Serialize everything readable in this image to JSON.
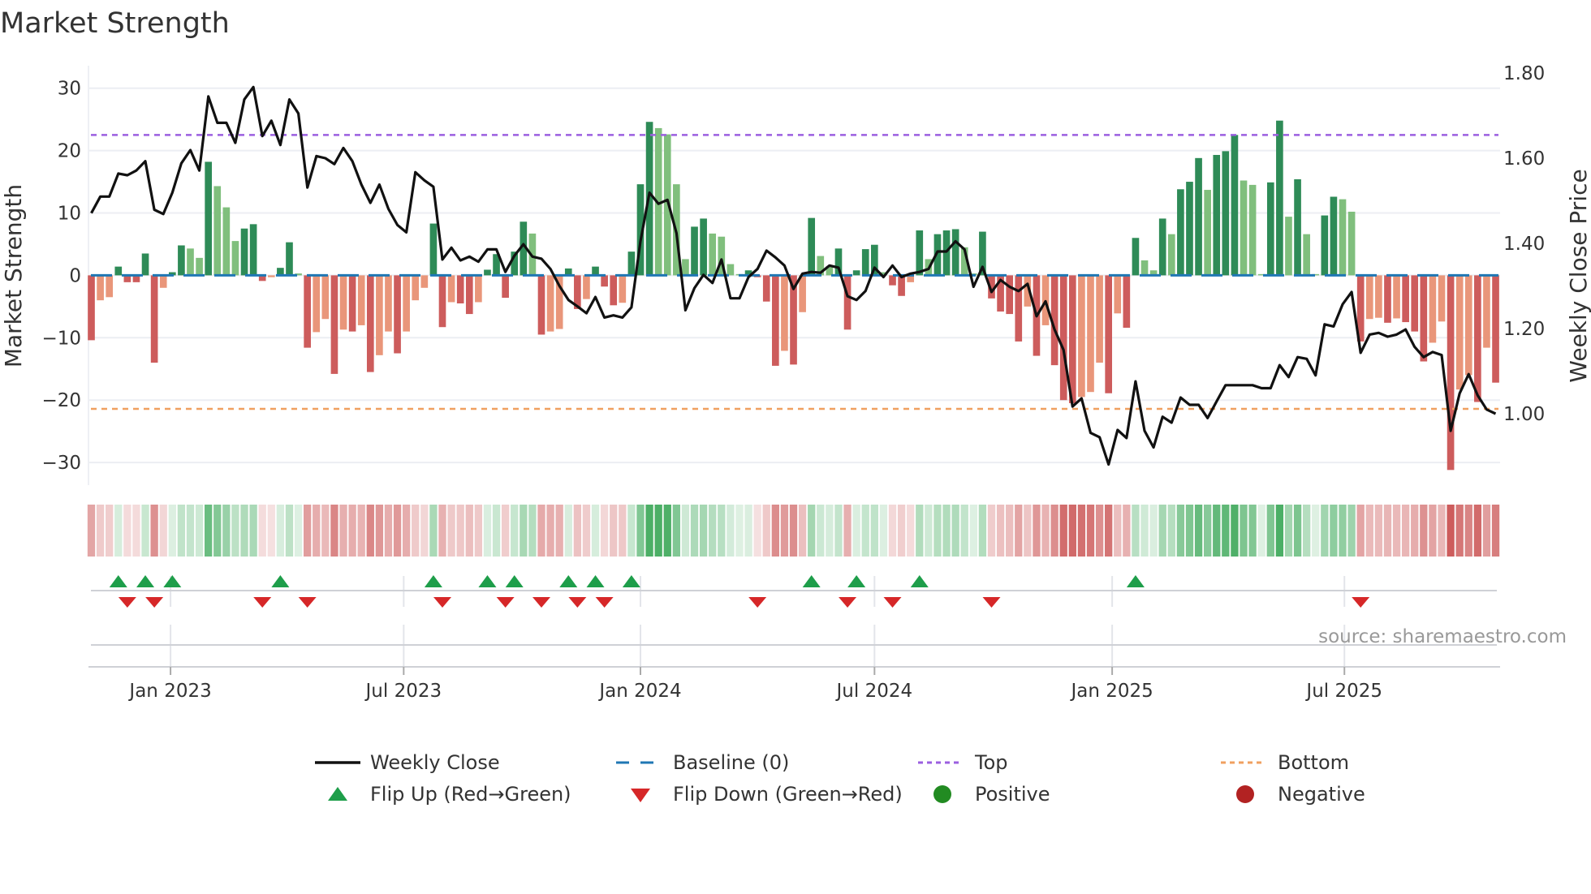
{
  "chart_data": {
    "type": "bar",
    "title": "Market Strength",
    "ylabel": "Market Strength",
    "y2label": "Weekly Close Price",
    "ylim": [
      -33,
      34
    ],
    "y2lim": [
      0.86,
      1.84
    ],
    "yticks": [
      30,
      20,
      10,
      0,
      -10,
      -20,
      -30
    ],
    "ytick_labels": [
      "30",
      "20",
      "10",
      "0",
      "−10",
      "−20",
      "−30"
    ],
    "y2ticks": [
      1.8,
      1.6,
      1.4,
      1.2,
      1.0
    ],
    "y2tick_labels": [
      "1.80",
      "1.60",
      "1.40",
      "1.20",
      "1.00"
    ],
    "xticks": [
      {
        "label": "Jan 2023",
        "week": 8.8
      },
      {
        "label": "Jul 2023",
        "week": 34.7
      },
      {
        "label": "Jan 2024",
        "week": 61.0
      },
      {
        "label": "Jul 2024",
        "week": 87.0
      },
      {
        "label": "Jan 2025",
        "week": 113.4
      },
      {
        "label": "Jul 2025",
        "week": 139.2
      }
    ],
    "grid": true,
    "top_level": 22.5,
    "bottom_level": -21.4,
    "baseline": 0,
    "strength": [
      -10.4,
      -4,
      -3.5,
      1.4,
      -1.1,
      -1.1,
      3.5,
      -14,
      -2,
      0.5,
      4.8,
      4.3,
      2.8,
      18.2,
      14.3,
      10.9,
      5.5,
      7.5,
      8.2,
      -0.9,
      -0.3,
      1.2,
      5.3,
      0.3,
      -11.6,
      -9.1,
      -7,
      -15.8,
      -8.7,
      -9,
      -8,
      -15.5,
      -12.8,
      -9,
      -12.5,
      -9,
      -4,
      -2,
      8.3,
      -8.3,
      -4.3,
      -4.5,
      -6.2,
      -4.3,
      0.9,
      3.4,
      -3.6,
      3.8,
      8.6,
      6.7,
      -9.5,
      -9,
      -8.6,
      1.1,
      -5.4,
      -3.8,
      1.4,
      -1.8,
      -4.8,
      -4.4,
      3.8,
      14.6,
      24.6,
      23.6,
      22.6,
      14.6,
      2.6,
      7.8,
      9.1,
      6.7,
      6.2,
      1.8,
      0.2,
      0.8,
      -0.3,
      -4.2,
      -14.5,
      -12.1,
      -14.3,
      -5.9,
      9.2,
      3.1,
      1.5,
      4.3,
      -8.7,
      0.8,
      4.2,
      4.9,
      0.5,
      -1.6,
      -3.3,
      -1.1,
      7.2,
      2.6,
      6.6,
      7.2,
      7.4,
      4.5,
      0.3,
      7,
      -3.7,
      -5.8,
      -6.2,
      -10.6,
      -5,
      -12.9,
      -8,
      -14.4,
      -20,
      -20.5,
      -19.5,
      -18.7,
      -14,
      -18.9,
      -6.1,
      -8.4,
      6,
      2.4,
      0.8,
      9.1,
      6.6,
      13.8,
      15,
      18.8,
      13.7,
      19.3,
      19.9,
      22.5,
      15.2,
      14.5,
      0.2,
      14.9,
      24.8,
      9.4,
      15.4,
      6.6,
      0.2,
      9.6,
      12.6,
      12.2,
      10.2,
      -10.6,
      -7,
      -6.8,
      -7.6,
      -6.9,
      -7.5,
      -9,
      -13.8,
      -10.8,
      -7.4,
      -31.2,
      -18.3,
      -16,
      -20.3,
      -11.6,
      -17.2
    ],
    "weekly_close": [
      1.471,
      1.51,
      1.51,
      1.564,
      1.56,
      1.571,
      1.593,
      1.479,
      1.469,
      1.519,
      1.588,
      1.619,
      1.571,
      1.745,
      1.683,
      1.683,
      1.636,
      1.738,
      1.767,
      1.652,
      1.688,
      1.631,
      1.738,
      1.705,
      1.531,
      1.605,
      1.6,
      1.586,
      1.624,
      1.593,
      1.538,
      1.495,
      1.538,
      1.481,
      1.443,
      1.426,
      1.567,
      1.548,
      1.533,
      1.362,
      1.39,
      1.36,
      1.369,
      1.357,
      1.386,
      1.386,
      1.333,
      1.371,
      1.398,
      1.369,
      1.364,
      1.34,
      1.3,
      1.267,
      1.252,
      1.236,
      1.274,
      1.226,
      1.231,
      1.226,
      1.25,
      1.405,
      1.519,
      1.493,
      1.502,
      1.424,
      1.243,
      1.295,
      1.326,
      1.307,
      1.362,
      1.271,
      1.271,
      1.321,
      1.34,
      1.383,
      1.367,
      1.348,
      1.293,
      1.329,
      1.333,
      1.331,
      1.348,
      1.343,
      1.276,
      1.267,
      1.288,
      1.343,
      1.321,
      1.348,
      1.321,
      1.329,
      1.333,
      1.34,
      1.381,
      1.381,
      1.405,
      1.386,
      1.298,
      1.345,
      1.286,
      1.314,
      1.298,
      1.288,
      1.305,
      1.229,
      1.264,
      1.198,
      1.15,
      1.017,
      1.036,
      0.955,
      0.945,
      0.881,
      0.962,
      0.943,
      1.076,
      0.96,
      0.921,
      0.993,
      0.979,
      1.038,
      1.021,
      1.021,
      0.99,
      1.029,
      1.067,
      1.067,
      1.067,
      1.067,
      1.06,
      1.06,
      1.114,
      1.086,
      1.133,
      1.129,
      1.09,
      1.21,
      1.205,
      1.257,
      1.286,
      1.143,
      1.186,
      1.19,
      1.181,
      1.186,
      1.198,
      1.157,
      1.133,
      1.145,
      1.138,
      0.96,
      1.048,
      1.093,
      1.043,
      1.01,
      1.0
    ],
    "flip_up_weeks": [
      3,
      6,
      9,
      21,
      38,
      44,
      47,
      53,
      56,
      60,
      80,
      85,
      92,
      116
    ],
    "flip_down_weeks": [
      4,
      7,
      19,
      24,
      39,
      46,
      50,
      54,
      57,
      74,
      84,
      89,
      100,
      141
    ],
    "legend": {
      "placement": "bottom",
      "weekly_close": "Weekly Close",
      "baseline": "Baseline (0)",
      "top": "Top",
      "bottom": "Bottom",
      "flip_up": "Flip Up (Red→Green)",
      "flip_down": "Flip Down (Green→Red)",
      "positive": "Positive",
      "negative": "Negative"
    }
  },
  "source": "source: sharemaestro.com",
  "colors": {
    "up_strong": "#2e8b57",
    "up_weak": "#80bf7d",
    "down_strong": "#cd5c5c",
    "down_weak": "#e9967a",
    "top": "#9b5fe0",
    "bottom": "#f0a060",
    "baseline": "#1f77b4",
    "flip_up": "#1e9e4a",
    "flip_down": "#d62728",
    "positive": "#228b22",
    "negative": "#b22222",
    "line": "#111111"
  }
}
